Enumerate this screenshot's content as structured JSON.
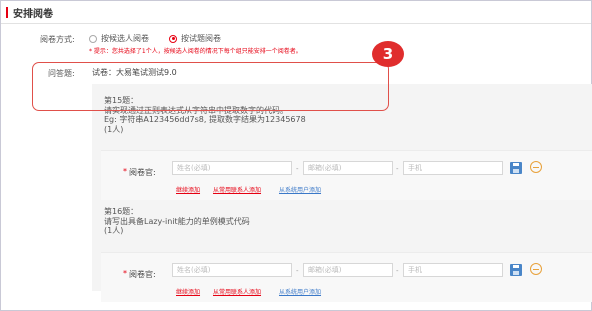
{
  "page": {
    "title": "安排阅卷"
  },
  "method": {
    "label": "阅卷方式:",
    "options": [
      "按候选人阅卷",
      "按试题阅卷"
    ],
    "selected_index": 1,
    "hint": "* 提示：您共选择了1个人，按候选人阅卷的情况下每个组只能安排一个阅卷者。"
  },
  "qa": {
    "label": "问答题:",
    "exam_name": "试卷：大易笔试测试9.0",
    "questions": [
      {
        "title": "第15题：",
        "lines": [
          "请实现通过正则表达式从字符串中提取数字的代码。",
          "Eg: 字符串A123456dd7s8, 提取数字结果为12345678"
        ],
        "count": "(1人)"
      },
      {
        "title": "第16题：",
        "lines": [
          "请写出具备Lazy-init能力的单例模式代码"
        ],
        "count": "(1人)"
      }
    ]
  },
  "assign": {
    "required_mark": "*",
    "label": "阅卷官:",
    "name_placeholder": "姓名(必填)",
    "email_placeholder": "邮箱(必填)",
    "phone_placeholder": "手机",
    "dash": "-",
    "links": {
      "continue": "继续添加",
      "contacts": "从常用联系人添加",
      "system": "从系统用户添加"
    }
  },
  "callout": {
    "number": "3"
  },
  "colors": {
    "accent": "#e60012",
    "link": "#3a78c8",
    "save": "#4a86c8",
    "remove": "#e8a23c"
  }
}
